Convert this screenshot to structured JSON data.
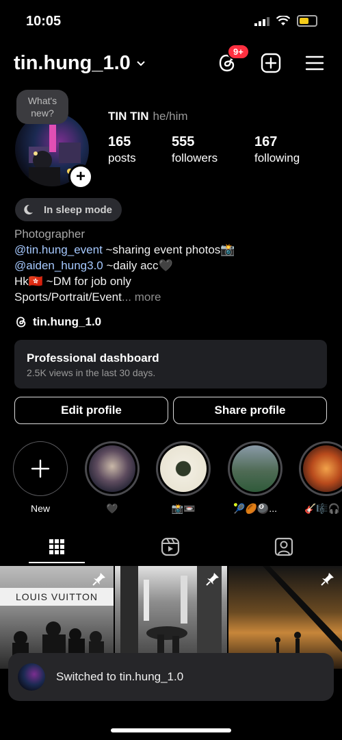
{
  "status": {
    "time": "10:05"
  },
  "header": {
    "username": "tin.hung_1.0",
    "notif_count": "9+"
  },
  "profile": {
    "note": [
      "What's",
      "new?"
    ],
    "display_name": "TIN TIN",
    "pronouns": "he/him",
    "stats": [
      {
        "num": "165",
        "label": "posts"
      },
      {
        "num": "555",
        "label": "followers"
      },
      {
        "num": "167",
        "label": "following"
      }
    ],
    "sleep_mode": "In sleep mode",
    "bio": {
      "category": "Photographer",
      "line1_mention": "@tin.hung_event",
      "line1_text": " ~sharing event photos📸",
      "line2_mention": "@aiden_hung3.0",
      "line2_text": " ~daily acc🖤",
      "line3": "Hk🇭🇰 ~DM for job only",
      "line4": "Sports/Portrait/Event",
      "more": "... more"
    },
    "threads_handle": "tin.hung_1.0"
  },
  "dashboard": {
    "title": "Professional dashboard",
    "subtitle": "2.5K views in the last 30 days."
  },
  "buttons": {
    "edit": "Edit profile",
    "share": "Share profile"
  },
  "highlights": [
    {
      "label": "New"
    },
    {
      "label": "🖤"
    },
    {
      "label": "📸📼"
    },
    {
      "label": "🎾🏉🎱..."
    },
    {
      "label": "🎸🎼🎧"
    }
  ],
  "posts": {
    "tile1_sign": "LOUIS VUITTON"
  },
  "toast": {
    "text": "Switched to tin.hung_1.0"
  },
  "colors": {
    "background": "#000000",
    "mention": "#a6c9ff",
    "badge": "#ff3040",
    "battery": "#f4cb19"
  }
}
